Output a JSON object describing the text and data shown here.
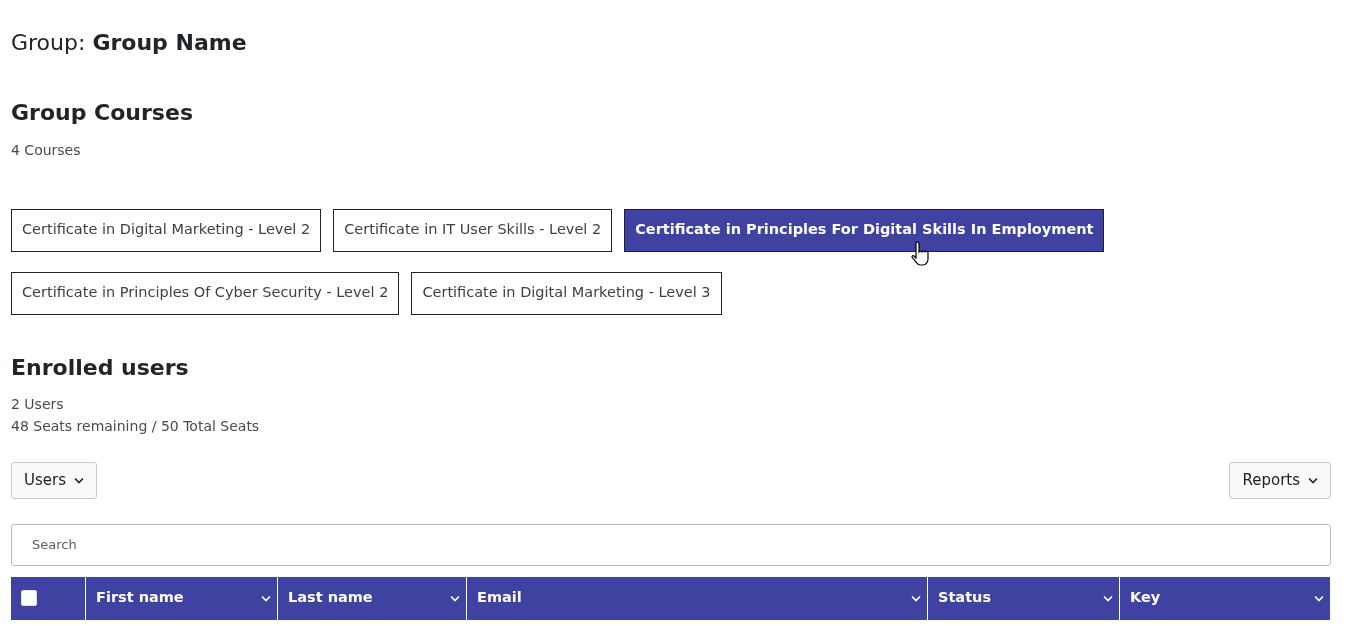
{
  "group": {
    "label": "Group:",
    "name": "Group Name"
  },
  "courses": {
    "title": "Group Courses",
    "count": "4 Courses",
    "items": [
      {
        "label": "Certificate in Digital Marketing - Level 2",
        "selected": false
      },
      {
        "label": "Certificate in IT User Skills - Level 2",
        "selected": false
      },
      {
        "label": "Certificate in Principles For Digital Skills In Employment",
        "selected": true
      },
      {
        "label": "Certificate in Principles Of Cyber Security - Level 2",
        "selected": false
      },
      {
        "label": "Certificate in Digital Marketing - Level 3",
        "selected": false
      }
    ]
  },
  "enrolled": {
    "title": "Enrolled users",
    "count": "2 Users",
    "seats": "48 Seats remaining / 50 Total Seats"
  },
  "toolbar": {
    "left_button": "Users",
    "right_button": "Reports"
  },
  "search": {
    "placeholder": "Search"
  },
  "table": {
    "select_all_checked": false,
    "columns": [
      "First name",
      "Last name",
      "Email",
      "Status",
      "Key"
    ]
  }
}
